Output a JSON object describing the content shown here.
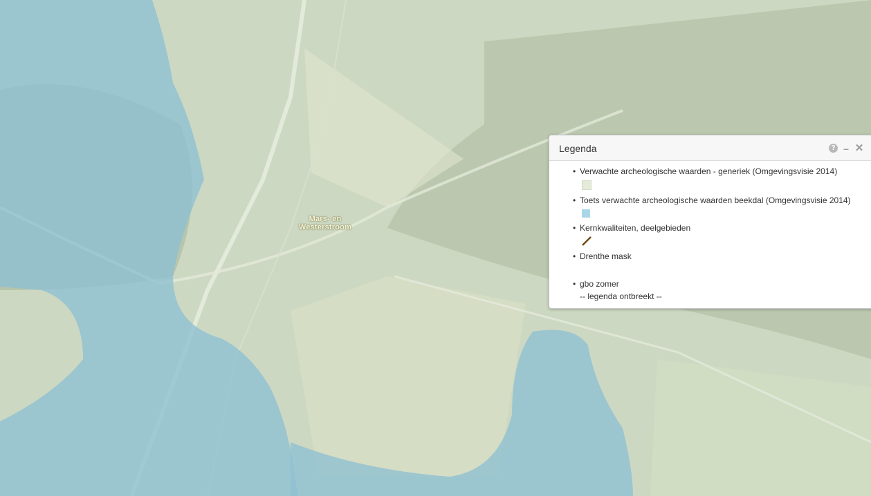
{
  "map": {
    "place_label_line1": "Mars- en",
    "place_label_line2": "Westerstroom",
    "colors": {
      "beekdal": "#7fb9d4",
      "generiek": "#dfe6cf",
      "terrain": "#c8d3bd"
    }
  },
  "legend": {
    "title": "Legenda",
    "tools": [
      "help-icon",
      "minimize-icon",
      "close-icon"
    ],
    "items": [
      {
        "label": "Verwachte archeologische waarden - generiek (Omgevingsvisie 2014)",
        "swatch": "#e4ecd9"
      },
      {
        "label": "Toets verwachte archeologische waarden beekdal (Omgevingsvisie 2014)",
        "swatch": "#a9d6e8"
      },
      {
        "label": "Kernkwaliteiten, deelgebieden",
        "swatch": "#6b4a12"
      },
      {
        "label": "Drenthe mask",
        "swatch": ""
      },
      {
        "label": "gbo zomer",
        "note": "-- legenda ontbreekt --"
      }
    ]
  }
}
